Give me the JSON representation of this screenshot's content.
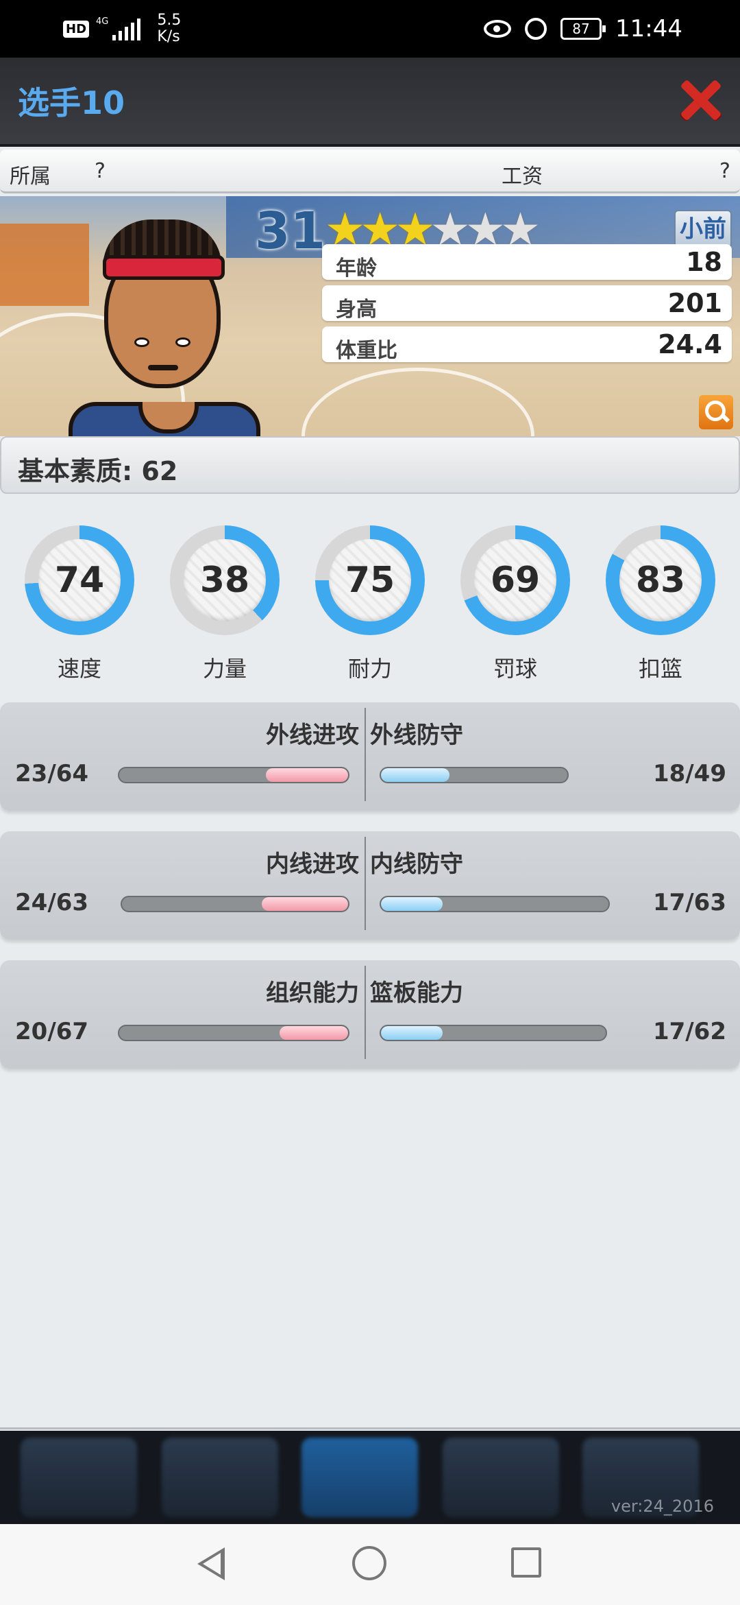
{
  "status_bar": {
    "hd": "HD",
    "network_gen": "4G",
    "net_speed_value": "5.5",
    "net_speed_unit": "K/s",
    "battery": "87",
    "time": "11:44"
  },
  "header": {
    "title": "选手10"
  },
  "affiliation": {
    "team_label": "所属",
    "team_value": "?",
    "salary_label": "工资",
    "salary_value": "?"
  },
  "player": {
    "overall": "31",
    "stars_filled": 3,
    "stars_total": 6,
    "position": "小前",
    "age_label": "年龄",
    "age": "18",
    "height_label": "身高",
    "height": "201",
    "bmi_label": "体重比",
    "bmi": "24.4"
  },
  "basic_quality": "基本素质: 62",
  "gauges": [
    {
      "label": "速度",
      "value": "74",
      "level": 74
    },
    {
      "label": "力量",
      "value": "38",
      "level": 38
    },
    {
      "label": "耐力",
      "value": "75",
      "level": 75
    },
    {
      "label": "罚球",
      "value": "69",
      "level": 69
    },
    {
      "label": "扣篮",
      "value": "83",
      "level": 83
    }
  ],
  "stat_panels": [
    {
      "left_title": "外线进攻",
      "left_value": "23/64",
      "left_current": 23,
      "left_max": 64,
      "right_title": "外线防守",
      "right_value": "18/49",
      "right_current": 18,
      "right_max": 49
    },
    {
      "left_title": "内线进攻",
      "left_value": "24/63",
      "left_current": 24,
      "left_max": 63,
      "right_title": "内线防守",
      "right_value": "17/63",
      "right_current": 17,
      "right_max": 63
    },
    {
      "left_title": "组织能力",
      "left_value": "20/67",
      "left_current": 20,
      "left_max": 67,
      "right_title": "篮板能力",
      "right_value": "17/62",
      "right_current": 17,
      "right_max": 62
    }
  ],
  "version": "ver:24_2016",
  "colors": {
    "accent_blue": "#3fa9ef",
    "ring_empty": "#d7d7d7",
    "title_blue": "#5aaaf0",
    "close_red": "#d42a24"
  },
  "icons": {
    "close": "close-icon",
    "search": "search-icon",
    "back": "back-icon",
    "home": "home-icon",
    "recent": "recent-icon"
  }
}
